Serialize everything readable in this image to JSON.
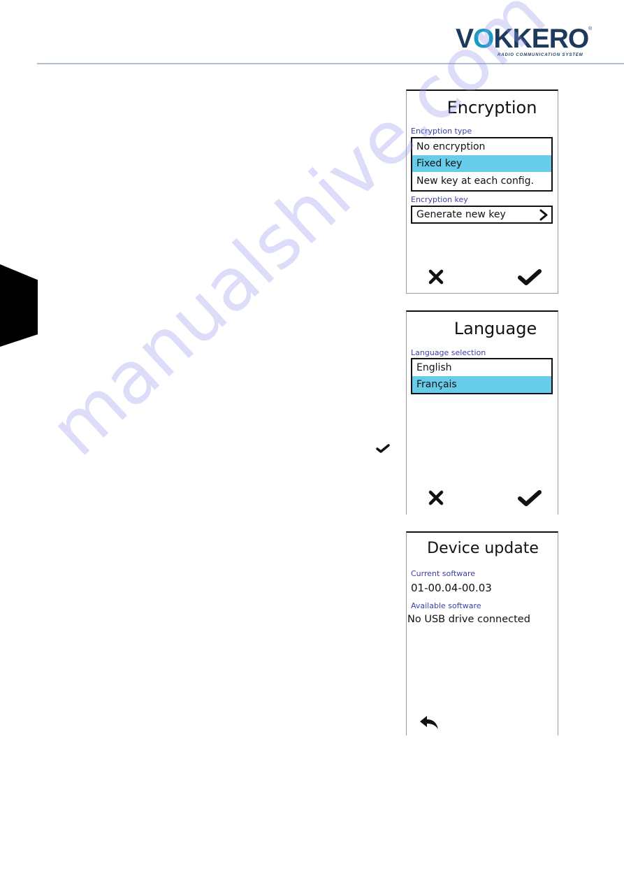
{
  "header": {
    "logo": {
      "word_left": "V",
      "word_bubble": "O",
      "word_right": "KKERO",
      "registered": "®",
      "tagline": "RADIO COMMUNICATION SYSTEM",
      "colors": {
        "navy": "#1d3a5c",
        "teal": "#1a9bc4"
      }
    },
    "rule_color": "#aebfcf"
  },
  "watermark": "manualshive.com",
  "colors": {
    "selected_highlight": "#66cce8",
    "field_label": "#3e3ea8",
    "text": "#111111"
  },
  "stray_icon": "check-icon",
  "screens": {
    "encryption": {
      "title": "Encryption",
      "type_label": "Encryption type",
      "options": [
        {
          "label": "No encryption",
          "selected": false
        },
        {
          "label": "Fixed key",
          "selected": true
        },
        {
          "label": "New key at each config.",
          "selected": false
        }
      ],
      "key_label": "Encryption key",
      "key_action": "Generate new key",
      "key_action_icon": "chevron-right-icon",
      "cancel_icon": "close-icon",
      "confirm_icon": "check-icon"
    },
    "language": {
      "title": "Language",
      "selection_label": "Language selection",
      "options": [
        {
          "label": "English",
          "selected": false
        },
        {
          "label": "Français",
          "selected": true
        }
      ],
      "cancel_icon": "close-icon",
      "confirm_icon": "check-icon"
    },
    "device_update": {
      "title": "Device update",
      "current_label": "Current software",
      "current_value": "01-00.04-00.03",
      "available_label": "Available software",
      "available_value": "No USB drive connected",
      "back_icon": "back-arrow-icon"
    }
  }
}
